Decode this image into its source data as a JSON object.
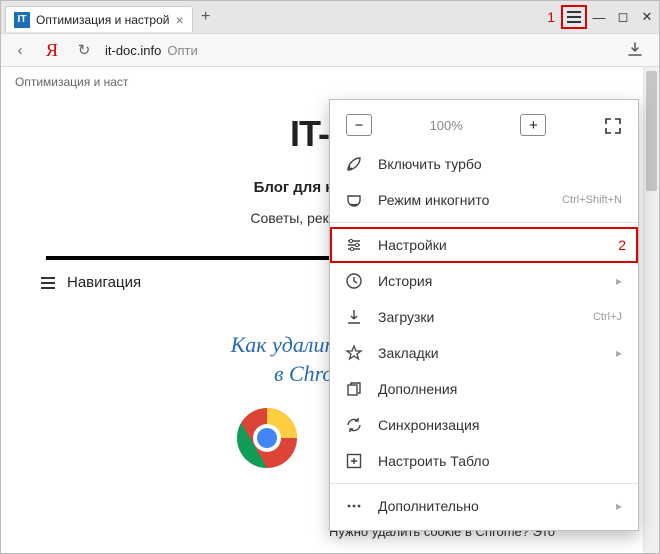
{
  "tab": {
    "title": "Оптимизация и настрой",
    "favicon_text": "IT"
  },
  "addr": {
    "back_glyph": "‹",
    "yandex_glyph": "Я",
    "reload_glyph": "↻",
    "domain": "it-doc.info",
    "after": "Опти"
  },
  "truncated": "Оптимизация и наст",
  "site": {
    "title": "IT-D",
    "subtitle": "Блог для начинаю",
    "tagline": "Советы, рекомендаци"
  },
  "nav_label": "Навигация",
  "article": {
    "line1": "Как удалить cookie",
    "line2": "в Chrome?"
  },
  "zoom": {
    "value": "100%"
  },
  "annot": {
    "one": "1",
    "two": "2"
  },
  "menu": [
    {
      "key": "turbo",
      "label": "Включить турбо"
    },
    {
      "key": "incognito",
      "label": "Режим инкогнито",
      "shortcut": "Ctrl+Shift+N"
    },
    {
      "key": "settings",
      "label": "Настройки",
      "highlight": true
    },
    {
      "key": "history",
      "label": "История",
      "submenu": true
    },
    {
      "key": "downloads",
      "label": "Загрузки",
      "shortcut": "Ctrl+J"
    },
    {
      "key": "bookmarks",
      "label": "Закладки",
      "submenu": true
    },
    {
      "key": "addons",
      "label": "Дополнения"
    },
    {
      "key": "sync",
      "label": "Синхронизация"
    },
    {
      "key": "tablo",
      "label": "Настроить Табло"
    },
    {
      "key": "more",
      "label": "Дополнительно",
      "submenu": true
    }
  ],
  "peek": {
    "heading": "Chrome?",
    "text": "Нужно удалить cookie в Chrome? Это"
  }
}
